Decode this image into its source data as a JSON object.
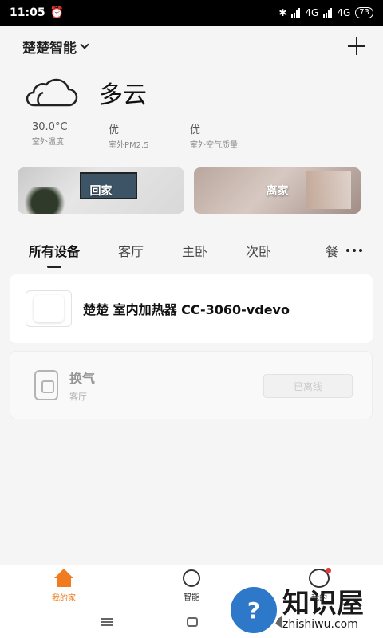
{
  "status_bar": {
    "time": "11:05",
    "network1": "4G",
    "network2": "4G",
    "battery": "73"
  },
  "header": {
    "home_name": "楚楚智能"
  },
  "weather": {
    "condition": "多云",
    "stats": [
      {
        "value": "30.0°C",
        "label": "室外温度"
      },
      {
        "value": "优",
        "label": "室外PM2.5"
      },
      {
        "value": "优",
        "label": "室外空气质量"
      }
    ]
  },
  "scenes": [
    {
      "label": "回家"
    },
    {
      "label": "离家"
    }
  ],
  "tabs": [
    "所有设备",
    "客厅",
    "主卧",
    "次卧",
    "餐"
  ],
  "devices": [
    {
      "name": "楚楚  室内加热器  CC-3060-vdevo",
      "room": ""
    },
    {
      "name": "换气",
      "room": "客厅",
      "status": "已离线"
    }
  ],
  "bottom_nav": [
    {
      "label": "我的家"
    },
    {
      "label": "智能"
    },
    {
      "label": "我的"
    }
  ],
  "watermark": {
    "cn": "知识屋",
    "en": "zhishiwu.com"
  }
}
